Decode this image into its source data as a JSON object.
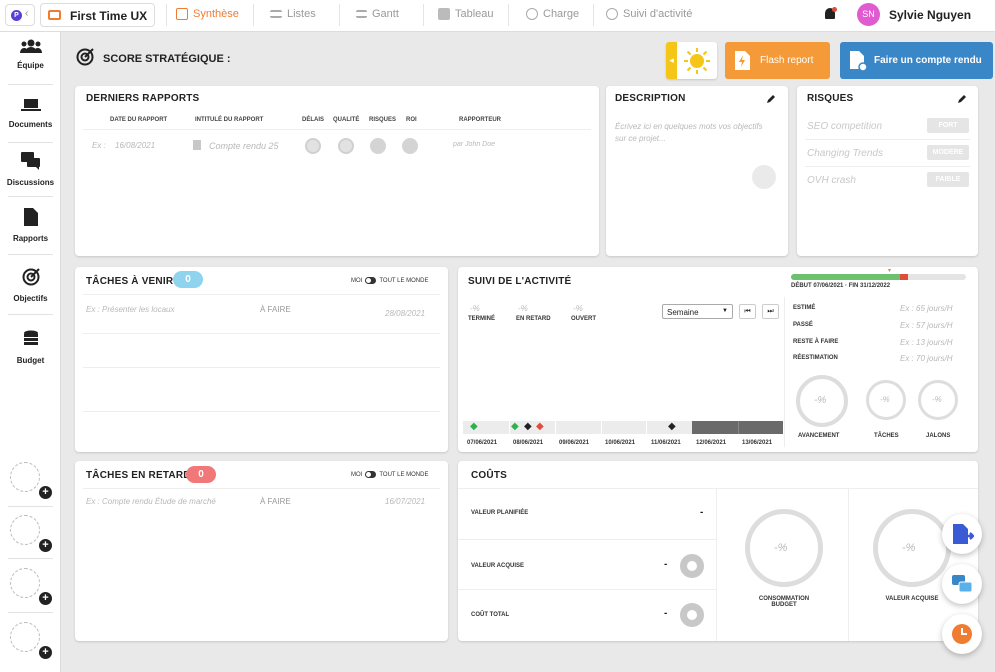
{
  "topbar": {
    "app_badge": "P",
    "project_title": "First Time UX",
    "tabs": [
      {
        "label": "Synthèse",
        "active": true
      },
      {
        "label": "Listes"
      },
      {
        "label": "Gantt"
      },
      {
        "label": "Tableau"
      },
      {
        "label": "Charge"
      },
      {
        "label": "Suivi d'activité"
      }
    ],
    "user_initials": "SN",
    "user_name": "Sylvie Nguyen"
  },
  "sidebar": {
    "items": [
      {
        "label": "Équipe"
      },
      {
        "label": "Documents"
      },
      {
        "label": "Discussions"
      },
      {
        "label": "Rapports"
      },
      {
        "label": "Objectifs"
      },
      {
        "label": "Budget"
      }
    ],
    "plus": "+"
  },
  "score": {
    "title": "SCORE STRATÉGIQUE :",
    "flash_report": "Flash report",
    "compte_rendu": "Faire un compte rendu"
  },
  "rapports": {
    "title": "DERNIERS RAPPORTS",
    "headers": [
      "DATE DU RAPPORT",
      "INTITULÉ DU RAPPORT",
      "DÉLAIS",
      "QUALITÉ",
      "RISQUES",
      "ROI",
      "RAPPORTEUR"
    ],
    "row": {
      "ex": "Ex :",
      "date": "16/08/2021",
      "title": "Compte rendu 25",
      "by": "par John Doe"
    }
  },
  "description": {
    "title": "DESCRIPTION",
    "placeholder": "Écrivez ici en quelques mots vos objectifs sur ce projet..."
  },
  "risques": {
    "title": "RISQUES",
    "items": [
      {
        "name": "SEO competition",
        "level": "FORT"
      },
      {
        "name": "Changing Trends",
        "level": "MODERE"
      },
      {
        "name": "OVH crash",
        "level": "FAIBLE"
      }
    ]
  },
  "taches_venir": {
    "title": "TÂCHES À VENIR",
    "count": "0",
    "moi": "MOI",
    "tout": "TOUT LE MONDE",
    "row": {
      "name": "Ex : Présenter les locaux",
      "status": "À FAIRE",
      "date": "28/08/2021"
    }
  },
  "taches_retard": {
    "title": "TÂCHES EN RETARD",
    "count": "0",
    "moi": "MOI",
    "tout": "TOUT LE MONDE",
    "row": {
      "name": "Ex : Compte rendu Étude de marché",
      "status": "À FAIRE",
      "date": "16/07/2021"
    }
  },
  "suivi": {
    "title": "SUIVI DE L'ACTIVITÉ",
    "period": "DÉBUT 07/06/2021 · FIN 31/12/2022",
    "progress": {
      "green": 0.62,
      "red": 0.05
    },
    "stats": [
      {
        "value": "-%",
        "label": "TERMINÉ"
      },
      {
        "value": "-%",
        "label": "EN RETARD"
      },
      {
        "value": "-%",
        "label": "OUVERT"
      }
    ],
    "select": "Semaine",
    "dates": [
      "07/06/2021",
      "08/06/2021",
      "09/06/2021",
      "10/06/2021",
      "11/06/2021",
      "12/06/2021",
      "13/06/2021"
    ],
    "metrics": [
      {
        "label": "ESTIMÉ",
        "value": "Ex : 65 jours/H"
      },
      {
        "label": "PASSÉ",
        "value": "Ex : 57 jours/H"
      },
      {
        "label": "RESTE À FAIRE",
        "value": "Ex : 13 jours/H"
      },
      {
        "label": "RÉESTIMATION",
        "value": "Ex : 70 jours/H"
      }
    ],
    "gauges": [
      {
        "value": "-%",
        "label": "AVANCEMENT"
      },
      {
        "value": "-%",
        "label": "TÂCHES"
      },
      {
        "value": "-%",
        "label": "JALONS"
      }
    ]
  },
  "couts": {
    "title": "COÛTS",
    "rows": [
      {
        "label": "VALEUR PLANIFIÉE",
        "value": "-"
      },
      {
        "label": "VALEUR ACQUISE",
        "value": "-"
      },
      {
        "label": "COÛT TOTAL",
        "value": "-"
      }
    ],
    "gauges": [
      {
        "value": "-%",
        "label": "CONSOMMATION BUDGET"
      },
      {
        "value": "-%",
        "label": "VALEUR ACQUISE"
      }
    ]
  },
  "colors": {
    "accent": "#f07c32",
    "blue": "#3a87c8",
    "yellow": "#f5c518",
    "green": "#6cc26c",
    "red": "#e04b3a",
    "badge_blue": "#8fd3ef",
    "badge_red": "#f07878",
    "avatar": "#e05ad0"
  }
}
